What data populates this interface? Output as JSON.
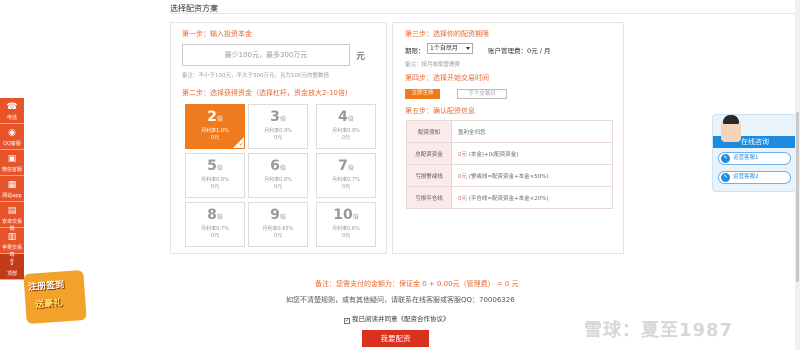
{
  "header": {
    "title": "选择配资方案"
  },
  "left": {
    "step1": {
      "label": "第一步：",
      "text": "输入投资本金"
    },
    "amount": {
      "placeholder": "最少100元，最多300万元",
      "unit": "元",
      "note": "备注：不小于100元，不大于300万元，且为100元的整数倍"
    },
    "step2": {
      "label": "第二步：",
      "text": "选择获得资金（选择杠杆，资金放大2-10倍）"
    },
    "tiles": [
      {
        "mult": "2",
        "suffix": "倍",
        "rate": "月利率1.0%",
        "fee": "0元",
        "selected": true
      },
      {
        "mult": "3",
        "suffix": "倍",
        "rate": "月利率0.9%",
        "fee": "0元"
      },
      {
        "mult": "4",
        "suffix": "倍",
        "rate": "月利率0.9%",
        "fee": "0元"
      },
      {
        "mult": "5",
        "suffix": "倍",
        "rate": "月利率0.8%",
        "fee": "0元"
      },
      {
        "mult": "6",
        "suffix": "倍",
        "rate": "月利率0.8%",
        "fee": "0元"
      },
      {
        "mult": "7",
        "suffix": "倍",
        "rate": "月利率0.7%",
        "fee": "0元"
      },
      {
        "mult": "8",
        "suffix": "倍",
        "rate": "月利率0.7%",
        "fee": "0元"
      },
      {
        "mult": "9",
        "suffix": "倍",
        "rate": "月利率0.65%",
        "fee": "0元"
      },
      {
        "mult": "10",
        "suffix": "倍",
        "rate": "月利率0.6%",
        "fee": "0元"
      }
    ]
  },
  "right": {
    "step3": {
      "label": "第三步：",
      "text": "选择你的配资期限"
    },
    "period_label": "期限：",
    "period_value": "1个自然月",
    "fee_label": "账户管理费：",
    "fee_value": "0元 / 月",
    "period_note": "备注：按月收取管理费",
    "step4": {
      "label": "第四步：",
      "text": "选择开始交易时间"
    },
    "btn_today": "立即生效",
    "btn_next": "下个交易日",
    "step5": {
      "label": "第五步：",
      "text": "确认配资信息"
    },
    "rows": [
      {
        "k": "配资须知",
        "v": "盈利全归您",
        "extra": ""
      },
      {
        "k": "总配资资金",
        "v": "0元",
        "extra": "(本金)+0(配资资金)"
      },
      {
        "k": "亏损警戒线",
        "v": "0元",
        "extra": "(警戒线=配资资金+本金×50%)"
      },
      {
        "k": "亏损平仓线",
        "v": "0元",
        "extra": "(平仓线=配资资金+本金×20%)"
      }
    ]
  },
  "sidebar": {
    "items": [
      {
        "icon": "phone-icon",
        "glyph": "☎",
        "label": "电话"
      },
      {
        "icon": "qq-icon",
        "glyph": "◉",
        "label": "QQ客服"
      },
      {
        "icon": "wechat-icon",
        "glyph": "▣",
        "label": "微信客服"
      },
      {
        "icon": "app-icon",
        "glyph": "▦",
        "label": "网站app"
      },
      {
        "icon": "android-icon",
        "glyph": "▤",
        "label": "安卓交易端"
      },
      {
        "icon": "apple-icon",
        "glyph": "▥",
        "label": "苹果交易端"
      },
      {
        "icon": "top-icon",
        "glyph": "⇧",
        "label": "顶部"
      }
    ]
  },
  "promo": {
    "line1": "注册签到",
    "line2": "送豪礼"
  },
  "cs": {
    "title": "在线咨询",
    "btn1": "运营客服1",
    "btn2": "运营客服2"
  },
  "footer": {
    "pay_note": "备注：您需支付的金额为：保证金 0 + 0.00元（管理费） = 0 元",
    "help": "如您不清楚规则，或有其他疑问，请联系在线客服或客服QQ：70006326",
    "agree": "我已阅读并同意《配资合作协议》",
    "submit": "我要配资"
  },
  "watermark": "雪球：夏至1987",
  "colors": {
    "accent": "#f07b1f",
    "submit": "#d8321c",
    "sidebar": "#e8542a",
    "cs": "#1c8be0"
  }
}
